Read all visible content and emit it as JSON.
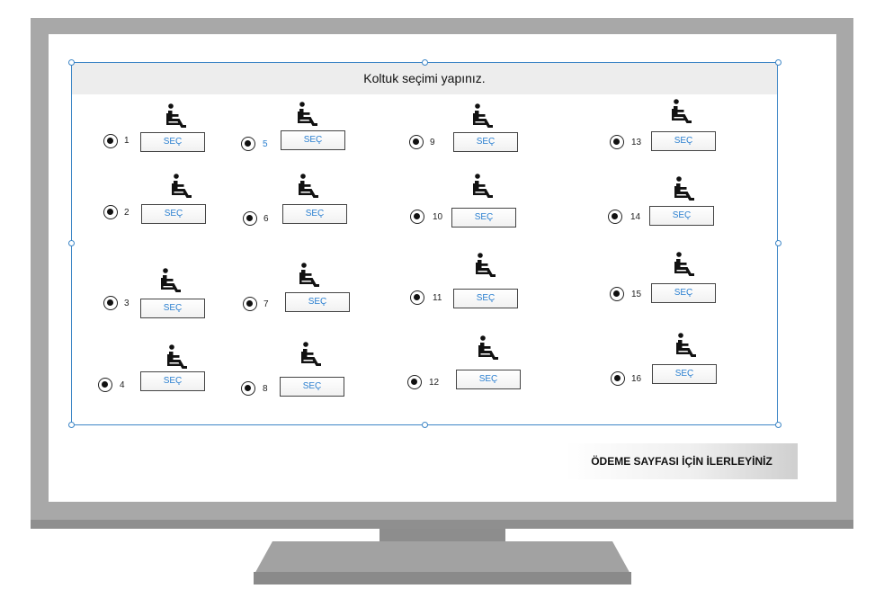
{
  "panel": {
    "title": "Koltuk seçimi yapınız."
  },
  "seats": [
    {
      "number": "1",
      "button_label": "SEÇ",
      "icon": "wheelchair-seat-icon"
    },
    {
      "number": "2",
      "button_label": "SEÇ",
      "icon": "wheelchair-seat-icon"
    },
    {
      "number": "3",
      "button_label": "SEÇ",
      "icon": "wheelchair-seat-icon"
    },
    {
      "number": "4",
      "button_label": "SEÇ",
      "icon": "wheelchair-seat-icon"
    },
    {
      "number": "5",
      "button_label": "SEÇ",
      "icon": "wheelchair-seat-icon"
    },
    {
      "number": "6",
      "button_label": "SEÇ",
      "icon": "wheelchair-seat-icon"
    },
    {
      "number": "7",
      "button_label": "SEÇ",
      "icon": "wheelchair-seat-icon"
    },
    {
      "number": "8",
      "button_label": "SEÇ",
      "icon": "wheelchair-seat-icon"
    },
    {
      "number": "9",
      "button_label": "SEÇ",
      "icon": "wheelchair-seat-icon"
    },
    {
      "number": "10",
      "button_label": "SEÇ",
      "icon": "wheelchair-seat-icon"
    },
    {
      "number": "11",
      "button_label": "SEÇ",
      "icon": "wheelchair-seat-icon"
    },
    {
      "number": "12",
      "button_label": "SEÇ",
      "icon": "wheelchair-seat-icon"
    },
    {
      "number": "13",
      "button_label": "SEÇ",
      "icon": "wheelchair-seat-icon"
    },
    {
      "number": "14",
      "button_label": "SEÇ",
      "icon": "wheelchair-seat-icon"
    },
    {
      "number": "15",
      "button_label": "SEÇ",
      "icon": "wheelchair-seat-icon"
    },
    {
      "number": "16",
      "button_label": "SEÇ",
      "icon": "wheelchair-seat-icon"
    }
  ],
  "proceed_button": {
    "label": "ÖDEME SAYFASI İÇİN İLERLEYİNİZ"
  },
  "colors": {
    "accent": "#2a7fd0",
    "selection_border": "#3d86c6",
    "header_background": "#ededed",
    "monitor_frame": "#a8a8a8"
  }
}
